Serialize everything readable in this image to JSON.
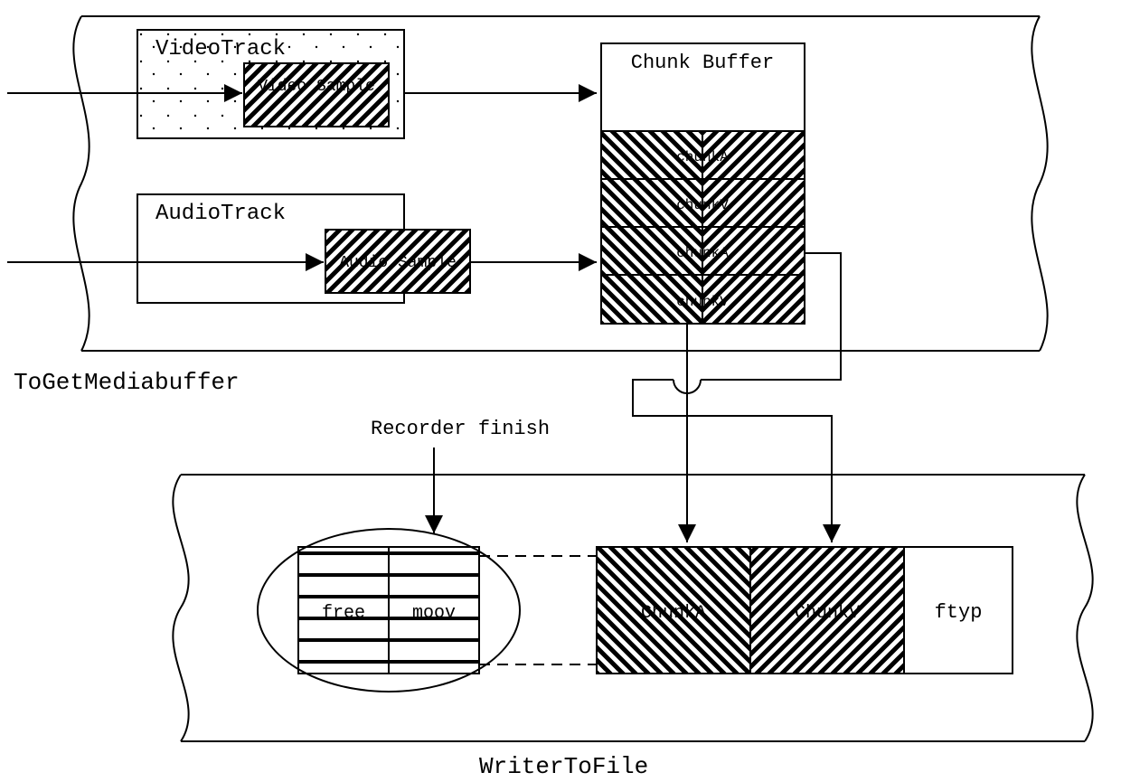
{
  "upper": {
    "label": "ToGetMediabuffer",
    "videoTrack": {
      "title": "VideoTrack",
      "sample": "Video Sample"
    },
    "audioTrack": {
      "title": "AudioTrack",
      "sample": "Audio Sample"
    },
    "chunkBuffer": {
      "title": "Chunk Buffer",
      "rows": [
        "chunkA",
        "chunkV",
        "chunkA",
        "chunkV"
      ]
    }
  },
  "lower": {
    "label": "WriterToFile",
    "recorderFinish": "Recorder finish",
    "blocks": {
      "free": "free",
      "moov": "moov",
      "chunkA": "ChunkA",
      "chunkV": "ChunkV",
      "ftyp": "ftyp"
    }
  }
}
